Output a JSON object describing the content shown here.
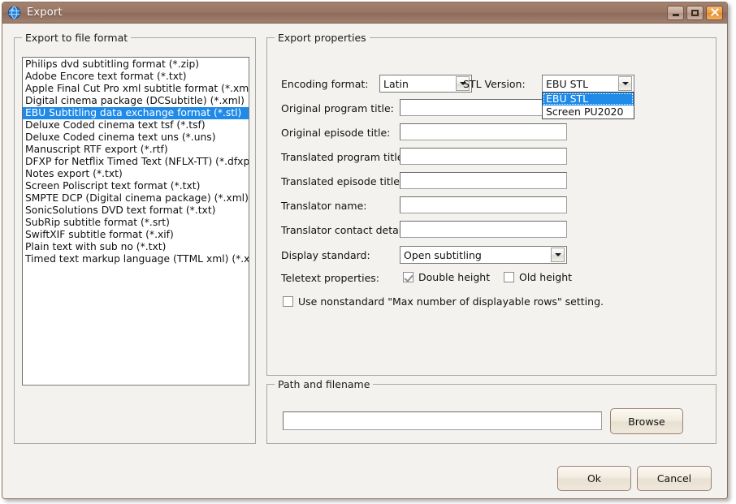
{
  "window": {
    "title": "Export",
    "icon": "globe-icon",
    "buttons": {
      "minimize": "Minimize",
      "maximize": "Maximize",
      "close": "Close"
    }
  },
  "format_group": {
    "legend": "Export to file format",
    "items": [
      "Philips dvd subtitling format (*.zip)",
      "Adobe Encore text format (*.txt)",
      "Apple Final Cut Pro xml subtitle format (*.xml)",
      "Digital cinema package (DCSubtitle) (*.xml)",
      "EBU Subtitling data exchange format (*.stl)",
      "Deluxe Coded cinema text tsf (*.tsf)",
      "Deluxe Coded cinema text uns (*.uns)",
      "Manuscript RTF export (*.rtf)",
      "DFXP for Netflix Timed Text (NFLX-TT) (*.dfxp)",
      "Notes export (*.txt)",
      "Screen Poliscript text format (*.txt)",
      "SMPTE DCP (Digital cinema package) (*.xml)",
      "SonicSolutions DVD text format (*.txt)",
      "SubRip subtitle format (*.srt)",
      "SwiftXIF subtitle format (*.xif)",
      "Plain text with sub no (*.txt)",
      "Timed text markup language (TTML xml) (*.xml)"
    ],
    "selected_index": 4
  },
  "properties_group": {
    "legend": "Export properties",
    "encoding_label": "Encoding format:",
    "encoding_value": "Latin",
    "stl_version_label": "STL Version:",
    "stl_version_value": "EBU STL",
    "stl_version_options": [
      "EBU STL",
      "Screen PU2020"
    ],
    "stl_version_selected_index": 0,
    "fields": [
      {
        "label": "Original program title:",
        "value": ""
      },
      {
        "label": "Original episode title:",
        "value": ""
      },
      {
        "label": "Translated program title:",
        "value": ""
      },
      {
        "label": "Translated episode title:",
        "value": ""
      },
      {
        "label": "Translator name:",
        "value": ""
      },
      {
        "label": "Translator contact details:",
        "value": ""
      }
    ],
    "display_standard_label": "Display standard:",
    "display_standard_value": "Open subtitling",
    "teletext_label": "Teletext properties:",
    "double_height_label": "Double height",
    "double_height_checked": true,
    "old_height_label": "Old height",
    "old_height_checked": false,
    "nonstandard_label": "Use nonstandard \"Max number of displayable rows\" setting.",
    "nonstandard_checked": false
  },
  "path_group": {
    "legend": "Path and filename",
    "path_value": "",
    "browse_label": "Browse"
  },
  "footer": {
    "ok_label": "Ok",
    "cancel_label": "Cancel"
  },
  "colors": {
    "selection_blue": "#1f8ae8",
    "titlebar_brown": "#9a7765",
    "close_orange": "#ef9b3c",
    "dialog_bg": "#f4f2ee"
  }
}
